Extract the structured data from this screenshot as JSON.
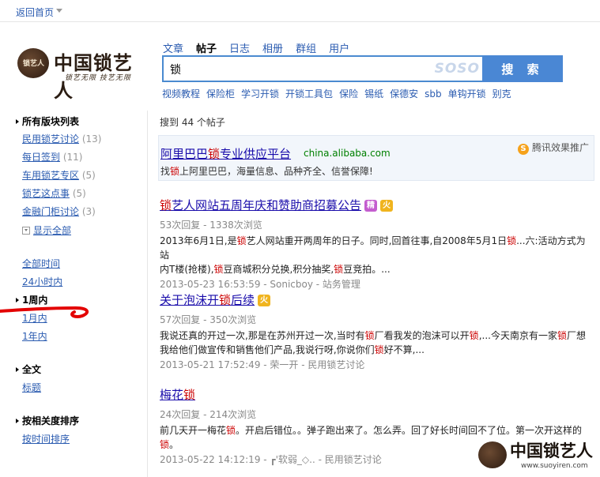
{
  "topbar": {
    "home_link": "返回首页"
  },
  "logo": {
    "seal_text": "锁艺人",
    "title": "中国锁艺人",
    "subtitle": "锁艺无限 技艺无限"
  },
  "tabs": [
    "文章",
    "帖子",
    "日志",
    "相册",
    "群组",
    "用户"
  ],
  "active_tab": "帖子",
  "search": {
    "value": "锁",
    "brand": "SOSO",
    "button": "搜 索"
  },
  "hot_words": [
    "视频教程",
    "保险柜",
    "学习开锁",
    "开锁工具包",
    "保险",
    "锡纸",
    "保德安",
    "sbb",
    "单钩开锁",
    "别克"
  ],
  "sidebar": {
    "boards_title": "所有版块列表",
    "boards": [
      {
        "label": "民用锁艺讨论",
        "count": "(13)"
      },
      {
        "label": "每日签到",
        "count": "(11)"
      },
      {
        "label": "车用锁艺专区",
        "count": "(5)"
      },
      {
        "label": "锁艺这点事",
        "count": "(5)"
      },
      {
        "label": "金融门柜讨论",
        "count": "(3)"
      }
    ],
    "show_all": "显示全部",
    "time_options": [
      "全部时间",
      "24小时内"
    ],
    "time_selected": "1周内",
    "time_options_after": [
      "1月内",
      "1年内"
    ],
    "scope_title": "全文",
    "scope_options": [
      "标题"
    ],
    "sort_title": "按相关度排序",
    "sort_options": [
      "按时间排序"
    ]
  },
  "results_count": "搜到 44 个帖子",
  "ad": {
    "title_prefix": "阿里巴巴",
    "title_hl": "锁",
    "title_suffix": "专业供应平台",
    "url": "china.alibaba.com",
    "desc_prefix": "找",
    "desc_hl": "锁",
    "desc_suffix": "上阿里巴巴，海量信息、品种齐全、信誉保障!",
    "tag": "腾讯效果推广",
    "tag_icon": "S"
  },
  "results": [
    {
      "title_hl": "锁",
      "title_rest": "艺人网站五周年庆和赞助商招募公告",
      "badges": [
        "精",
        "火"
      ],
      "meta": "53次回复 - 1338次浏览",
      "snippet_1a": "2013年6月1日,是",
      "snippet_1b": "锁",
      "snippet_1c": "艺人网站重开两周年的日子。同时,回首往事,自2008年5月1日",
      "snippet_1d": "锁",
      "snippet_1e": "...六:活动方式为站",
      "snippet_2a": "内T楼(抢楼),",
      "snippet_2b": "锁",
      "snippet_2c": "豆商城积分兑换,积分抽奖,",
      "snippet_2d": "锁",
      "snippet_2e": "豆竞拍。...",
      "info": "2013-05-23 16:53:59 - Sonicboy - 站务管理"
    },
    {
      "title_a": "关于泡沫开",
      "title_hl": "锁",
      "title_rest": "后续",
      "badges": [
        "火"
      ],
      "meta": "57次回复 - 350次浏览",
      "snippet_1a": "我说还真的开过一次,那是在苏州开过一次,当时有",
      "snippet_1b": "锁",
      "snippet_1c": "厂看我发的泡沫可以开",
      "snippet_1d": "锁",
      "snippet_1e": ",...今天南京有一家",
      "snippet_1f": "锁",
      "snippet_1g": "厂想",
      "snippet_2a": "我给他们做宣传和销售他们产品,我说行呀,你说你们",
      "snippet_2b": "锁",
      "snippet_2c": "好不算,...",
      "info": "2013-05-21 17:52:49 - 荣一开 - 民用锁艺讨论"
    },
    {
      "title_a": "梅花",
      "title_hl": "锁",
      "meta": "24次回复 - 214次浏览",
      "snippet_1a": "前几天开一梅花",
      "snippet_1b": "锁",
      "snippet_1c": "。开启后错位。。弹子跑出来了。怎么弄。回了好长时间回不了位。第一次开这样的",
      "snippet_2b": "锁",
      "snippet_2c": "。",
      "info": "2013-05-22 14:12:19 - ┏'软弱_◇.. - 民用锁艺讨论"
    }
  ],
  "watermark": {
    "title": "中国锁艺人",
    "url": "www.suoyiren.com",
    "seal_text": "锁艺人"
  },
  "colors": {
    "link": "#2a5bb0",
    "highlight": "#cc0000",
    "button": "#4a87d4",
    "annotation": "#e30000"
  }
}
